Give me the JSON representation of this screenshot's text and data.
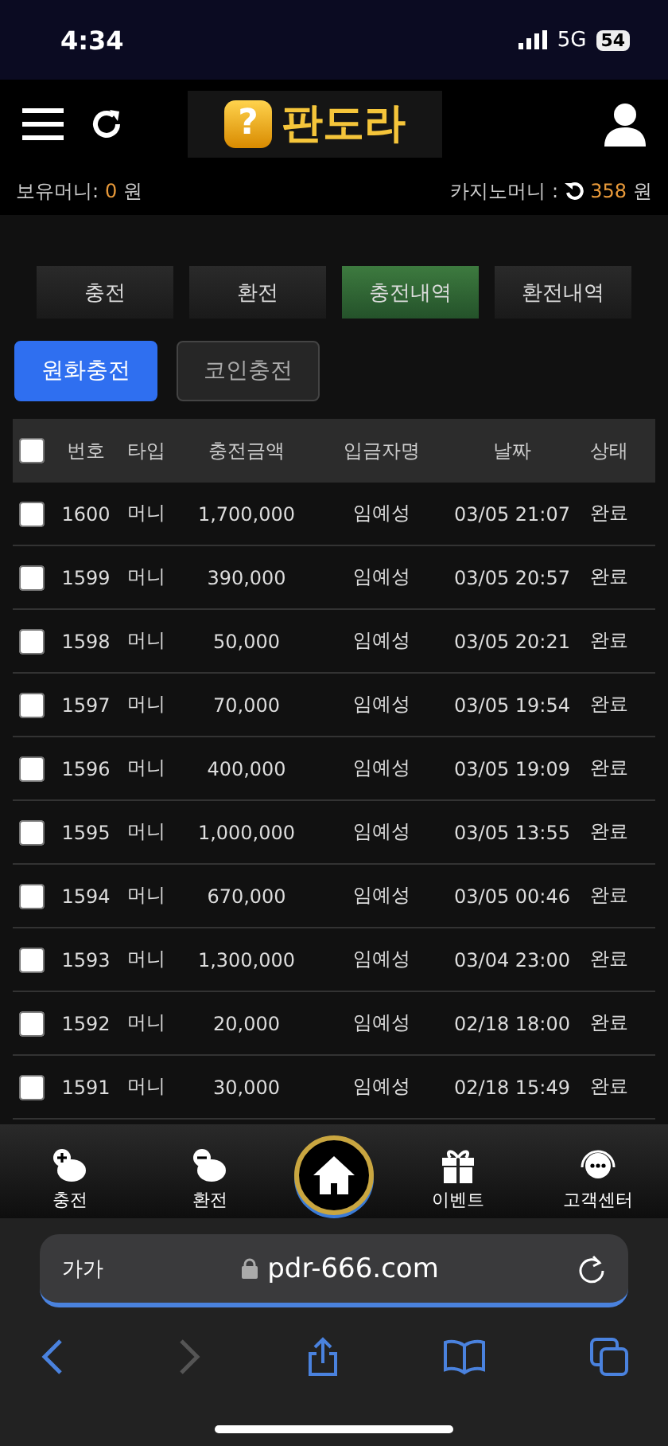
{
  "status_bar": {
    "time": "4:34",
    "network": "5G",
    "battery": "54"
  },
  "header": {
    "logo_mark": "?",
    "logo_text": "판도라"
  },
  "balance": {
    "label": "보유머니:",
    "amount": "0",
    "unit": "원",
    "casino_label": "카지노머니 :",
    "casino_amount": "358",
    "casino_unit": "원"
  },
  "tabs": [
    {
      "label": "충전",
      "selected": false
    },
    {
      "label": "환전",
      "selected": false
    },
    {
      "label": "충전내역",
      "selected": true
    },
    {
      "label": "환전내역",
      "selected": false
    }
  ],
  "subtabs": [
    {
      "label": "원화충전",
      "selected": true
    },
    {
      "label": "코인충전",
      "selected": false
    }
  ],
  "table": {
    "select_all": false,
    "columns": [
      "번호",
      "타입",
      "충전금액",
      "입금자명",
      "날짜",
      "상태"
    ],
    "rows": [
      {
        "checked": false,
        "cells": [
          "1600",
          "머니",
          "1,700,000",
          "임예성",
          "03/05 21:07",
          "완료"
        ]
      },
      {
        "checked": false,
        "cells": [
          "1599",
          "머니",
          "390,000",
          "임예성",
          "03/05 20:57",
          "완료"
        ]
      },
      {
        "checked": false,
        "cells": [
          "1598",
          "머니",
          "50,000",
          "임예성",
          "03/05 20:21",
          "완료"
        ]
      },
      {
        "checked": false,
        "cells": [
          "1597",
          "머니",
          "70,000",
          "임예성",
          "03/05 19:54",
          "완료"
        ]
      },
      {
        "checked": false,
        "cells": [
          "1596",
          "머니",
          "400,000",
          "임예성",
          "03/05 19:09",
          "완료"
        ]
      },
      {
        "checked": false,
        "cells": [
          "1595",
          "머니",
          "1,000,000",
          "임예성",
          "03/05 13:55",
          "완료"
        ]
      },
      {
        "checked": false,
        "cells": [
          "1594",
          "머니",
          "670,000",
          "임예성",
          "03/05 00:46",
          "완료"
        ]
      },
      {
        "checked": false,
        "cells": [
          "1593",
          "머니",
          "1,300,000",
          "임예성",
          "03/04 23:00",
          "완료"
        ]
      },
      {
        "checked": false,
        "cells": [
          "1592",
          "머니",
          "20,000",
          "임예성",
          "02/18 18:00",
          "완료"
        ]
      },
      {
        "checked": false,
        "cells": [
          "1591",
          "머니",
          "30,000",
          "임예성",
          "02/18 15:49",
          "완료"
        ]
      }
    ]
  },
  "bottom_nav": [
    {
      "kind": "deposit",
      "label": "충전"
    },
    {
      "kind": "withdraw",
      "label": "환전"
    },
    {
      "kind": "home"
    },
    {
      "kind": "event",
      "label": "이벤트"
    },
    {
      "kind": "support",
      "label": "고객센터"
    }
  ],
  "browser": {
    "text_size": "가가",
    "url": "pdr-666.com"
  }
}
